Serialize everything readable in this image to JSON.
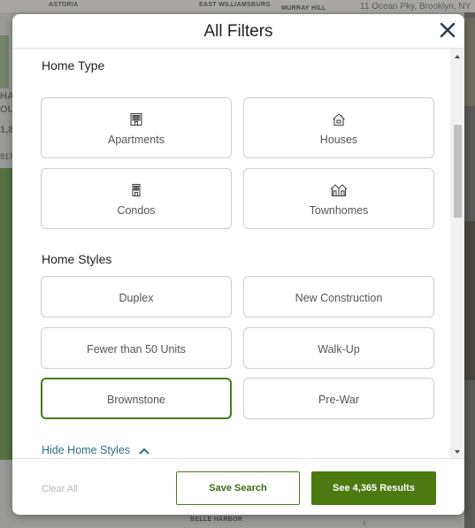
{
  "map": {
    "labels": [
      "ASTORIA",
      "EAST WILLIAMSBURG",
      "MURRAY HILL",
      "BELLE HARBOR"
    ],
    "address": "11 Ocean Pky, Brooklyn, NY",
    "left_text": [
      "HA",
      "OU",
      "1,8",
      "917"
    ]
  },
  "modal": {
    "title": "All Filters",
    "close_icon": "close-icon"
  },
  "home_type": {
    "heading": "Home Type",
    "options": [
      {
        "label": "Apartments",
        "icon": "apartment-building-icon"
      },
      {
        "label": "Houses",
        "icon": "house-icon"
      },
      {
        "label": "Condos",
        "icon": "condo-building-icon"
      },
      {
        "label": "Townhomes",
        "icon": "townhome-icon"
      }
    ]
  },
  "home_styles": {
    "heading": "Home Styles",
    "options": [
      {
        "label": "Duplex",
        "selected": false
      },
      {
        "label": "New Construction",
        "selected": false
      },
      {
        "label": "Fewer than 50 Units",
        "selected": false
      },
      {
        "label": "Walk-Up",
        "selected": false
      },
      {
        "label": "Brownstone",
        "selected": true
      },
      {
        "label": "Pre-War",
        "selected": false
      }
    ],
    "toggle_label": "Hide Home Styles"
  },
  "footer": {
    "clear_all": "Clear All",
    "save_search": "Save Search",
    "see_results": "See 4,365 Results"
  },
  "colors": {
    "accent_green": "#4a7a10",
    "selected_border": "#4a7a1e",
    "link_blue": "#2f6f86"
  }
}
